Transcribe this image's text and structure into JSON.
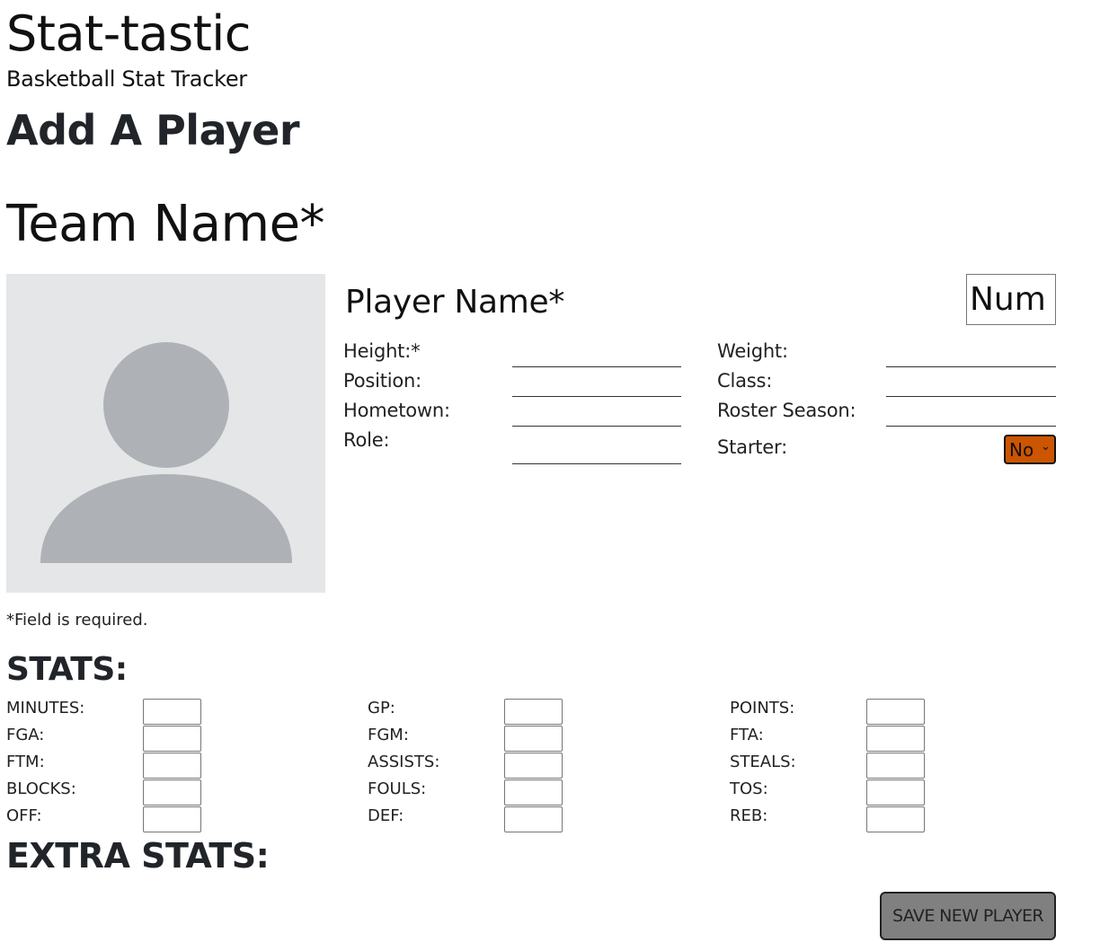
{
  "header": {
    "title": "Stat-tastic",
    "subtitle": "Basketball Stat Tracker"
  },
  "page_heading": "Add A Player",
  "team_name": {
    "placeholder": "Team Name*",
    "value": ""
  },
  "player": {
    "name_placeholder": "Player Name*",
    "number_placeholder": "Num",
    "photo_icon": "avatar-placeholder-icon",
    "fields": {
      "height_label": "Height:*",
      "position_label": "Position:",
      "hometown_label": "Hometown:",
      "role_label": "Role:",
      "weight_label": "Weight:",
      "class_label": "Class:",
      "roster_season_label": "Roster Season:",
      "starter_label": "Starter:"
    },
    "starter": {
      "selected": "No",
      "accent_color": "#cc5500"
    }
  },
  "required_note": "*Field is required.",
  "stats": {
    "heading": "STATS:",
    "labels": {
      "minutes": "MINUTES:",
      "gp": "GP:",
      "points": "POINTS:",
      "fga": "FGA:",
      "fgm": "FGM:",
      "fta": "FTA:",
      "ftm": "FTM:",
      "assists": "ASSISTS:",
      "steals": "STEALS:",
      "blocks": "BLOCKS:",
      "fouls": "FOULS:",
      "tos": "TOS:",
      "off": "OFF:",
      "def": "DEF:",
      "reb": "REB:"
    }
  },
  "extra_stats_heading": "EXTRA STATS:",
  "actions": {
    "save_label": "SAVE NEW PLAYER",
    "save_color": "#808080"
  }
}
